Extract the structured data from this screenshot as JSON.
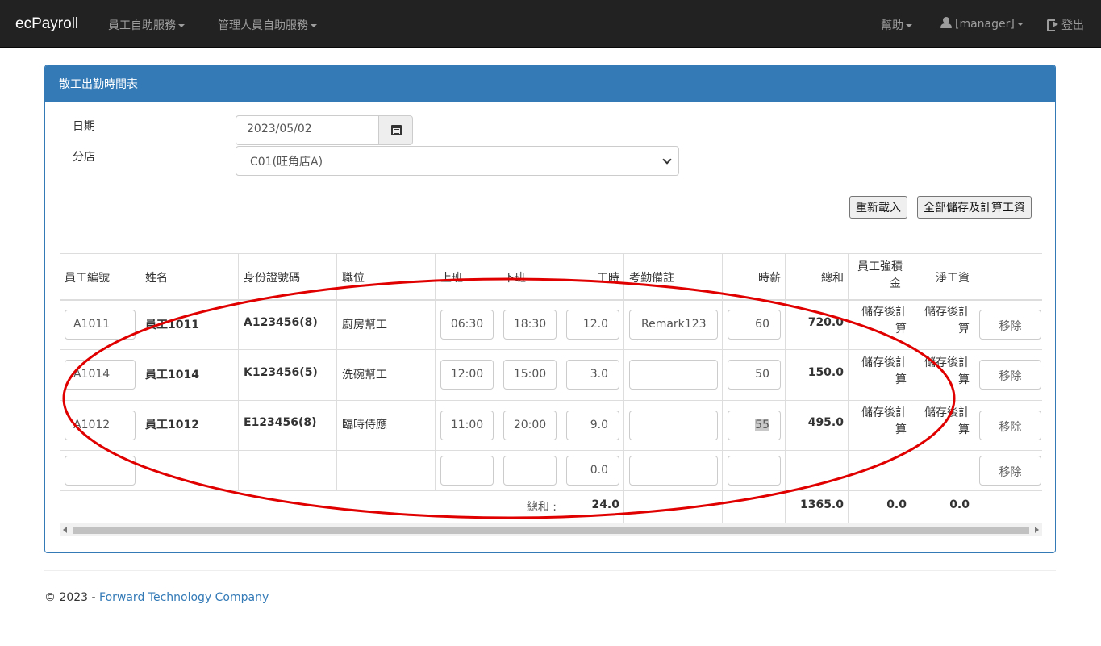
{
  "navbar": {
    "brand": "ecPayroll",
    "menu_employee": "員工自助服務",
    "menu_manager": "管理人員自助服務",
    "help": "幫助",
    "user": "[manager]",
    "logout": "登出"
  },
  "panel": {
    "title": "散工出勤時間表"
  },
  "form": {
    "date_label": "日期",
    "date_value": "2023/05/02",
    "branch_label": "分店",
    "branch_value": "C01(旺角店A)"
  },
  "buttons": {
    "reload": "重新載入",
    "save_all": "全部儲存及計算工資"
  },
  "table": {
    "headers": {
      "emp_id": "員工編號",
      "name": "姓名",
      "id_no": "身份證號碼",
      "position": "職位",
      "on_duty": "上班",
      "off_duty": "下班",
      "hours": "工時",
      "remark": "考勤備註",
      "hourly_rate": "時薪",
      "total": "總和",
      "mpf_line1": "員工強積",
      "mpf_line2": "金",
      "net_pay": "淨工資"
    },
    "rows": [
      {
        "emp_id": "A1011",
        "name": "員工1011",
        "id_no": "A123456(8)",
        "position": "廚房幫工",
        "on": "06:30",
        "off": "18:30",
        "hours": "12.0",
        "remark": "Remark123",
        "rate": "60",
        "total": "720.0",
        "mpf_l1": "儲存後計",
        "mpf_l2": "算",
        "net_l1": "儲存後計",
        "net_l2": "算",
        "remove": "移除"
      },
      {
        "emp_id": "A1014",
        "name": "員工1014",
        "id_no": "K123456(5)",
        "position": "洗碗幫工",
        "on": "12:00",
        "off": "15:00",
        "hours": "3.0",
        "remark": "",
        "rate": "50",
        "total": "150.0",
        "mpf_l1": "儲存後計",
        "mpf_l2": "算",
        "net_l1": "儲存後計",
        "net_l2": "算",
        "remove": "移除"
      },
      {
        "emp_id": "A1012",
        "name": "員工1012",
        "id_no": "E123456(8)",
        "position": "臨時侍應",
        "on": "11:00",
        "off": "20:00",
        "hours": "9.0",
        "remark": "",
        "rate": "55",
        "total": "495.0",
        "mpf_l1": "儲存後計",
        "mpf_l2": "算",
        "net_l1": "儲存後計",
        "net_l2": "算",
        "remove": "移除"
      }
    ],
    "blank_row": {
      "hours": "0.0",
      "remove": "移除"
    },
    "totals": {
      "label": "總和 :",
      "hours": "24.0",
      "total": "1365.0",
      "mpf": "0.0",
      "net": "0.0"
    }
  },
  "footer": {
    "copyright": "© 2023 - ",
    "company": "Forward Technology Company"
  },
  "annotation": {
    "color": "#e00000"
  }
}
